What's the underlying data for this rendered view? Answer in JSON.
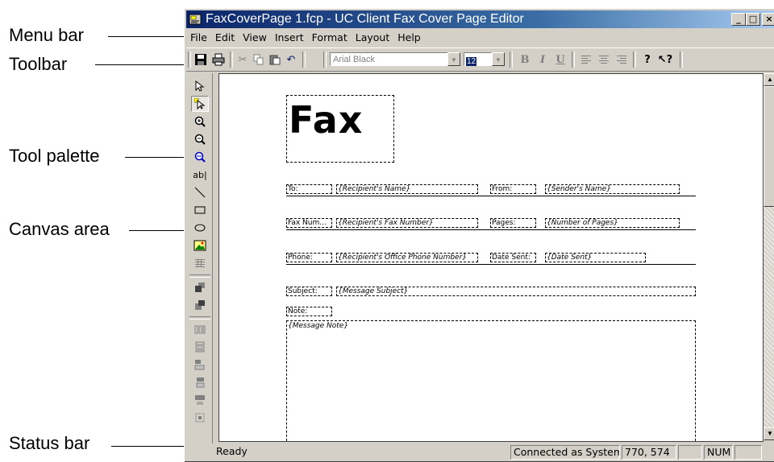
{
  "callouts": {
    "menu_bar": "Menu bar",
    "toolbar": "Toolbar",
    "tool_palette": "Tool palette",
    "canvas_area": "Canvas area",
    "status_bar": "Status bar"
  },
  "window": {
    "title": "FaxCoverPage 1.fcp - UC Client Fax Cover Page Editor",
    "minimize": "_",
    "maximize": "□",
    "close": "×"
  },
  "menu": [
    "File",
    "Edit",
    "View",
    "Insert",
    "Format",
    "Layout",
    "Help"
  ],
  "toolbar": {
    "font_name": "Arial Black",
    "font_size": "12",
    "bold": "B",
    "italic": "I",
    "underline": "U"
  },
  "palette_tools": [
    "select-arrow",
    "select-object",
    "zoom-in",
    "zoom-out",
    "zoom-fit",
    "text-field",
    "line",
    "rectangle",
    "ellipse",
    "image",
    "table"
  ],
  "canvas": {
    "title": "Fax",
    "fields": {
      "to_label": "To:",
      "to_value": "{Recipient's Name}",
      "from_label": "From:",
      "from_value": "{Sender's Name}",
      "fax_label": "Fax Num...",
      "fax_value": "{Recipient's Fax Number}",
      "pages_label": "Pages:",
      "pages_value": "{Number of Pages}",
      "phone_label": "Phone:",
      "phone_value": "{Recipient's Office Phone Number}",
      "date_label": "Date Sent:",
      "date_value": "{Date Sent}",
      "subject_label": "Subject:",
      "subject_value": "{Message Subject}",
      "note_label": "Note:",
      "note_value": "{Message Note}"
    }
  },
  "status": {
    "ready": "Ready",
    "connection": "Connected as System",
    "coords": "770, 574",
    "num": "NUM"
  }
}
